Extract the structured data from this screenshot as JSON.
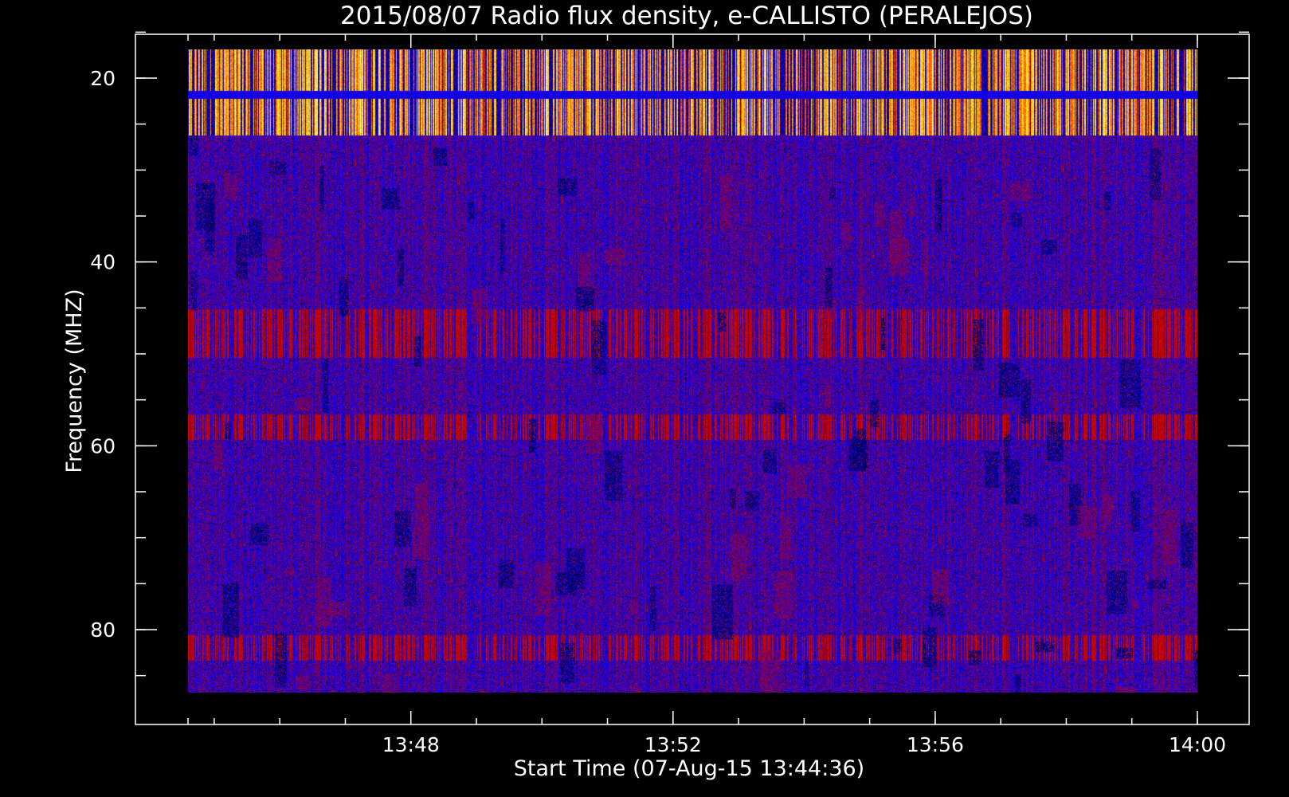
{
  "chart_data": {
    "type": "heatmap",
    "title": "2015/08/07  Radio flux density, e-CALLISTO (PERALEJOS)",
    "xlabel": "Start Time (07-Aug-15 13:44:36)",
    "ylabel": "Frequency (MHZ)",
    "x_start_minutes": 0,
    "x_end_minutes": 15.4,
    "xlim": [
      "13:44:36",
      "14:00:00"
    ],
    "ylim": [
      90,
      14.7
    ],
    "y_data_range": [
      16.9,
      86.9
    ],
    "x_ticks": [
      {
        "label": "13:48",
        "minutes": 3.4
      },
      {
        "label": "13:52",
        "minutes": 7.4
      },
      {
        "label": "13:56",
        "minutes": 11.4
      },
      {
        "label": "14:00",
        "minutes": 15.4
      }
    ],
    "y_ticks": [
      {
        "label": "20",
        "value": 20
      },
      {
        "label": "40",
        "value": 40
      },
      {
        "label": "60",
        "value": 60
      },
      {
        "label": "80",
        "value": 80
      }
    ],
    "x_minor_step_minutes": 1,
    "y_minor_step": 5,
    "colormap": [
      "#000000",
      "#0000ff",
      "#c00000",
      "#ff5000",
      "#ffd000",
      "#ffffc0"
    ],
    "bright_band_mhz": [
      16.9,
      26.2
    ],
    "emission_lines_mhz": [
      46.5,
      49,
      58,
      82
    ],
    "grid": false,
    "legend": "none"
  }
}
